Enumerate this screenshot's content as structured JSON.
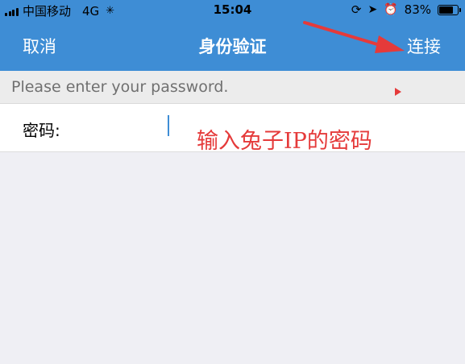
{
  "status_bar": {
    "carrier": "中国移动",
    "network": "4G",
    "time": "15:04",
    "battery": "83%",
    "battery_level": 0.83
  },
  "nav": {
    "cancel_label": "取消",
    "title": "身份验证",
    "connect_label": "连接"
  },
  "hint": "Please enter your password.",
  "password_field": {
    "label": "密码:",
    "value": ""
  },
  "annotation": {
    "text": "输入兔子IP的密码",
    "color": "#e53a3a"
  },
  "colors": {
    "header": "#3e8dd5",
    "background": "#efeff4"
  }
}
